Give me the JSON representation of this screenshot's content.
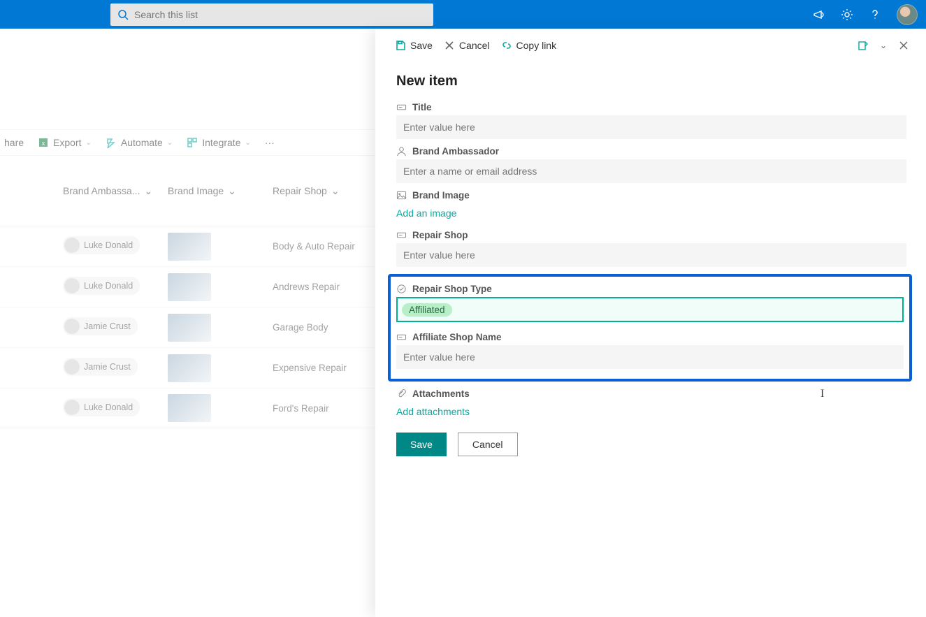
{
  "suite": {
    "search_placeholder": "Search this list"
  },
  "commandbar": {
    "share": "hare",
    "export": "Export",
    "automate": "Automate",
    "integrate": "Integrate"
  },
  "columns": {
    "ambassador": "Brand Ambassa...",
    "image": "Brand Image",
    "shop": "Repair Shop"
  },
  "rows": [
    {
      "ambassador": "Luke Donald",
      "shop": "Body & Auto Repair"
    },
    {
      "ambassador": "Luke Donald",
      "shop": "Andrews Repair"
    },
    {
      "ambassador": "Jamie Crust",
      "shop": "Garage Body"
    },
    {
      "ambassador": "Jamie Crust",
      "shop": "Expensive Repair"
    },
    {
      "ambassador": "Luke Donald",
      "shop": "Ford's Repair"
    }
  ],
  "panel": {
    "save": "Save",
    "cancel": "Cancel",
    "copy_link": "Copy link",
    "title": "New item",
    "fields": {
      "title_label": "Title",
      "title_ph": "Enter value here",
      "ambassador_label": "Brand Ambassador",
      "ambassador_ph": "Enter a name or email address",
      "image_label": "Brand Image",
      "image_action": "Add an image",
      "shop_label": "Repair Shop",
      "shop_ph": "Enter value here",
      "shop_type_label": "Repair Shop Type",
      "shop_type_value": "Affiliated",
      "affiliate_label": "Affiliate Shop Name",
      "affiliate_ph": "Enter value here",
      "attachments_label": "Attachments",
      "attachments_action": "Add attachments"
    },
    "btn_save": "Save",
    "btn_cancel": "Cancel"
  }
}
